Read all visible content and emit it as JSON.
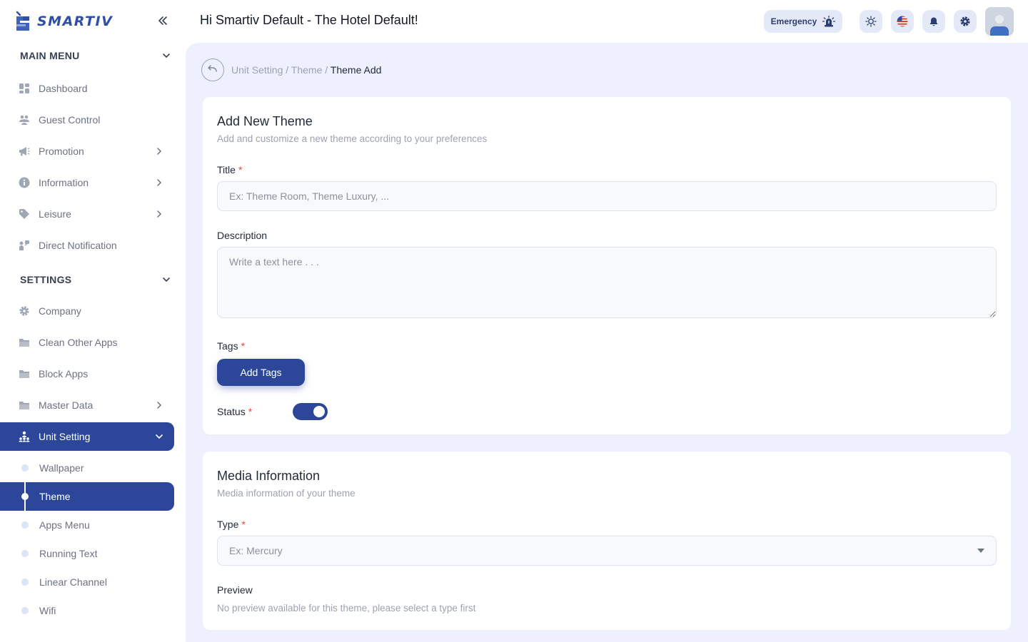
{
  "brand": {
    "name": "SMARTIV",
    "color": "#2f4fa6"
  },
  "sidebar": {
    "main_menu_title": "MAIN MENU",
    "main_items": [
      {
        "label": "Dashboard",
        "icon": "grid-icon"
      },
      {
        "label": "Guest Control",
        "icon": "users-icon"
      },
      {
        "label": "Promotion",
        "icon": "megaphone-icon"
      },
      {
        "label": "Information",
        "icon": "info-icon"
      },
      {
        "label": "Leisure",
        "icon": "tag-icon"
      },
      {
        "label": "Direct Notification",
        "icon": "notification-icon"
      }
    ],
    "settings_title": "SETTINGS",
    "settings_items": [
      {
        "label": "Company",
        "icon": "gear-icon"
      },
      {
        "label": "Clean Other Apps",
        "icon": "folder-icon"
      },
      {
        "label": "Block Apps",
        "icon": "folder-icon"
      },
      {
        "label": "Master Data",
        "icon": "folder-icon"
      },
      {
        "label": "Unit Setting",
        "icon": "sitemap-icon"
      }
    ],
    "unit_setting_sub": [
      {
        "label": "Wallpaper"
      },
      {
        "label": "Theme"
      },
      {
        "label": "Apps Menu"
      },
      {
        "label": "Running Text"
      },
      {
        "label": "Linear Channel"
      },
      {
        "label": "Wifi"
      }
    ]
  },
  "header": {
    "greeting": "Hi Smartiv Default - The Hotel Default!",
    "emergency_label": "Emergency"
  },
  "breadcrumb": {
    "part1": "Unit Setting",
    "part2": "Theme",
    "current": "Theme Add",
    "separator": " / "
  },
  "theme_form": {
    "title": "Add New Theme",
    "subtitle": "Add and customize a new theme according to your preferences",
    "title_label": "Title",
    "title_placeholder": "Ex: Theme Room, Theme Luxury, ...",
    "description_label": "Description",
    "description_placeholder": "Write a text here . . .",
    "tags_label": "Tags",
    "add_tags_button": "Add Tags",
    "status_label": "Status",
    "status_on": true,
    "required_mark": "*"
  },
  "media_form": {
    "title": "Media Information",
    "subtitle": "Media information of your theme",
    "type_label": "Type",
    "type_placeholder": "Ex: Mercury",
    "preview_label": "Preview",
    "preview_text": "No preview available for this theme, please select a type first"
  },
  "colors": {
    "primary": "#2c4799",
    "main_bg": "#eef1fd",
    "required": "#ef4444"
  }
}
